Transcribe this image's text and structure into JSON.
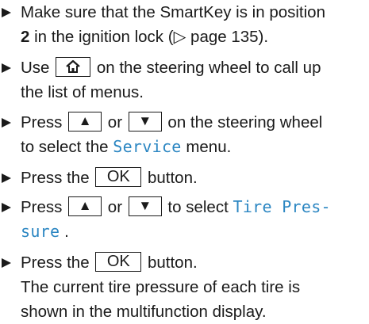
{
  "steps": [
    {
      "line1": "Make sure that the SmartKey is in position",
      "position_value": "2",
      "line2_rest": " in the ignition lock (▷ page 135)."
    },
    {
      "line1_pre": "Use ",
      "home_key": "home-icon",
      "line1_post": " on the steering wheel to call up",
      "line2": "the list of menus."
    },
    {
      "line1_pre": "Press ",
      "up_key": "▲",
      "or": " or ",
      "down_key": "▼",
      "line1_post": " on the steering wheel",
      "line2_pre": "to select the ",
      "menu_name": "Service",
      "line2_post": " menu."
    },
    {
      "line1_pre": "Press the ",
      "ok_key": "OK",
      "line1_post": " button."
    },
    {
      "line1_pre": "Press ",
      "up_key": "▲",
      "or": " or ",
      "down_key": "▼",
      "line1_mid": " to select ",
      "menu_name_1": "Tire Pres-",
      "menu_name_2": "sure",
      "line2_post": " ."
    },
    {
      "line1_pre": "Press the ",
      "ok_key": "OK",
      "line1_post": " button.",
      "line2": "The current tire pressure of each tire is",
      "line3": "shown in the multifunction display."
    }
  ],
  "colors": {
    "text": "#1a1a1a",
    "menu_text": "#2b86c2"
  }
}
